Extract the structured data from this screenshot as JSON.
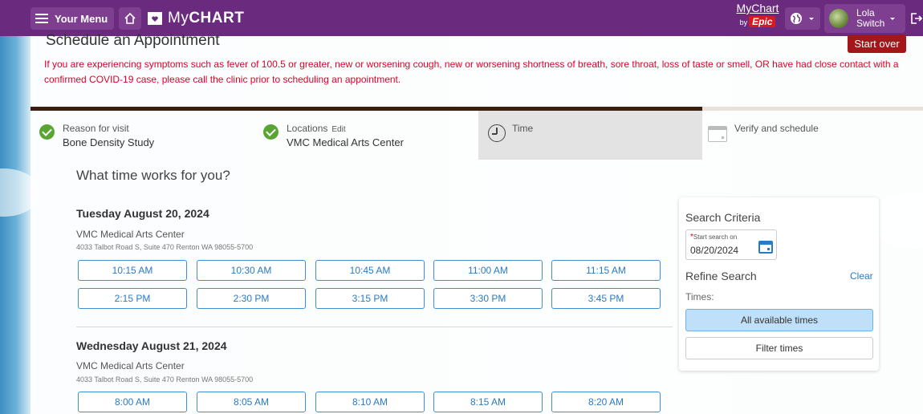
{
  "header": {
    "menu_label": "Your Menu",
    "logo_text_prefix": "My",
    "logo_text_bold": "CHART",
    "brand_mychart": "MyChart",
    "brand_by": "by",
    "brand_epic": "Epic",
    "user_first": "Lola",
    "user_last": "Switch",
    "bar_color": "#6a2a7e"
  },
  "page": {
    "title": "Schedule an Appointment",
    "start_over_label": "Start over",
    "warning": "If you are experiencing symptoms such as fever of 100.5 or greater, new or worsening cough, new or worsening shortness of breath, sore throat, loss of taste or smell, OR have had close contact with a confirmed COVID-19 case, please call the clinic prior to scheduling an appointment.",
    "question": "What time works for you?"
  },
  "steps": [
    {
      "title": "Reason for visit",
      "value": "Bone Density Study",
      "status": "complete",
      "icon": "check-icon"
    },
    {
      "title": "Locations",
      "edit": "Edit",
      "value": "VMC Medical Arts Center",
      "status": "complete",
      "icon": "check-icon"
    },
    {
      "title": "Time",
      "status": "current",
      "icon": "clock-icon"
    },
    {
      "title": "Verify and schedule",
      "status": "upcoming",
      "icon": "calendar-icon"
    }
  ],
  "days": [
    {
      "heading": "Tuesday August 20, 2024",
      "location": "VMC Medical Arts Center",
      "address": "4033 Talbot Road S, Suite 470 Renton WA 98055-5700",
      "slots": [
        "10:15 AM",
        "10:30 AM",
        "10:45 AM",
        "11:00 AM",
        "11:15 AM",
        "2:15 PM",
        "2:30 PM",
        "3:15 PM",
        "3:30 PM",
        "3:45 PM"
      ]
    },
    {
      "heading": "Wednesday August 21, 2024",
      "location": "VMC Medical Arts Center",
      "address": "4033 Talbot Road S, Suite 470 Renton WA 98055-5700",
      "slots": [
        "8:00 AM",
        "8:05 AM",
        "8:10 AM",
        "8:15 AM",
        "8:20 AM"
      ]
    }
  ],
  "search": {
    "title": "Search Criteria",
    "required_mark": "*",
    "start_label": "Start search on",
    "start_value": "08/20/2024",
    "refine_title": "Refine Search",
    "clear_label": "Clear",
    "times_label": "Times:",
    "all_times_label": "All available times",
    "filter_times_label": "Filter times"
  }
}
